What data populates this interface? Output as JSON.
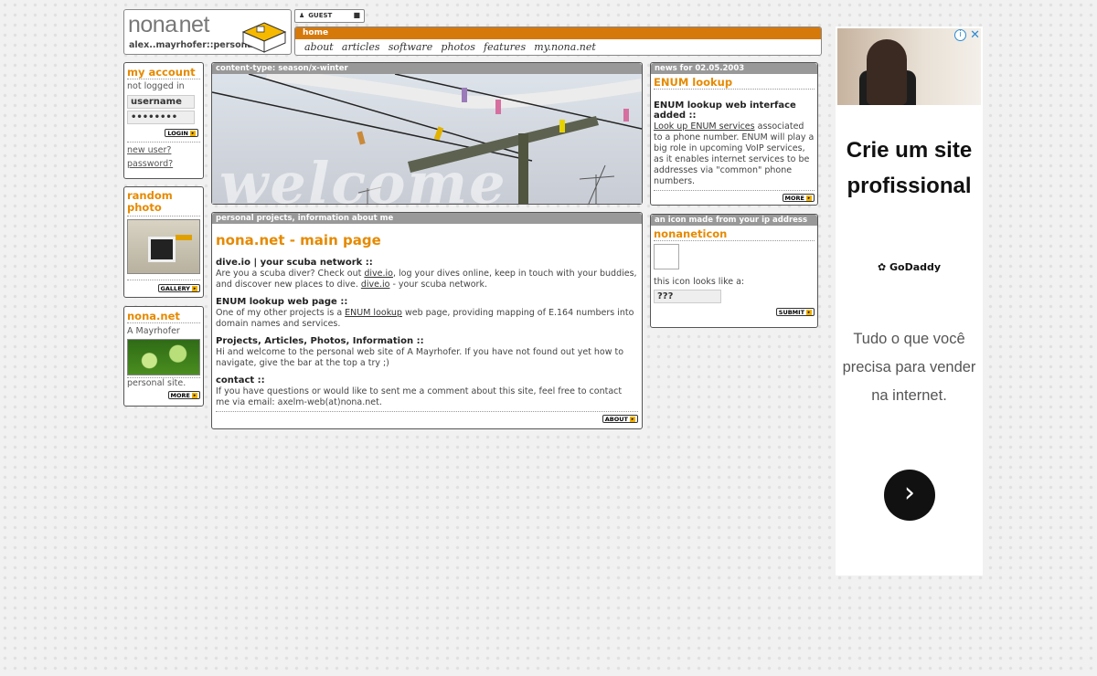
{
  "logo": {
    "site": "nona",
    "dot": ".",
    "tld": "net",
    "tagline": "alex..mayrhofer::personal"
  },
  "user_bar": {
    "label": "GUEST"
  },
  "nav": {
    "current": "home",
    "links": [
      "about",
      "articles",
      "software",
      "photos",
      "features",
      "my.nona.net"
    ]
  },
  "account": {
    "title": "my account",
    "status": "not logged in",
    "username_value": "username",
    "password_value": "••••••••",
    "login_button": "LOGIN",
    "new_user": "new user?",
    "forgot": "password?"
  },
  "random_photo": {
    "title": "random photo",
    "gallery_button": "GALLERY"
  },
  "nona_box": {
    "title": "nona.net",
    "owner": "A Mayrhofer",
    "caption": "personal site.",
    "more_button": "MORE"
  },
  "winter": {
    "tab": "content-type: season/x-winter",
    "overlay": "welcome"
  },
  "main": {
    "tab": "personal projects, information about me",
    "title": "nona.net - main page",
    "sections": [
      {
        "heading": "dive.io | your scuba network ::",
        "pre": "Are you a scuba diver? Check out ",
        "link1": "dive.io",
        "mid": ", log your dives online, keep in touch with your buddies, and discover new places to dive. ",
        "link2": "dive.io",
        "post": " - your scuba network."
      },
      {
        "heading": "ENUM lookup web page ::",
        "pre": "One of my other projects is a ",
        "link1": "ENUM lookup",
        "post": " web page, providing mapping of E.164 numbers into domain names and services."
      },
      {
        "heading": "Projects, Articles, Photos, Information ::",
        "text": "Hi and welcome to the personal web site of A Mayrhofer. If you have not found out yet how to navigate, give the bar at the top a try ;)"
      },
      {
        "heading": "contact ::",
        "text": "If you have questions or would like to sent me a comment about this site, feel free to contact me via email: axelm-web(at)nona.net."
      }
    ],
    "about_button": "ABOUT"
  },
  "news": {
    "tab": "news for 02.05.2003",
    "title": "ENUM lookup",
    "headline": "ENUM lookup web interface added ::",
    "link": "Look up ENUM services",
    "text": " associated to a phone number. ENUM will play a big role in upcoming VoIP services, as it enables internet services to be addresses via \"common\" phone numbers.",
    "more_button": "MORE"
  },
  "ipicon": {
    "tab": "an icon made from your ip address",
    "title": "nonaneticon",
    "looks_like": "this icon looks like a:",
    "value": "???",
    "submit_button": "SUBMIT"
  },
  "ad": {
    "headline": "Crie um site profissional",
    "brand": "GoDaddy",
    "body": "Tudo o que você precisa para vender na internet.",
    "info_icon": "info-icon",
    "close_icon": "close-icon",
    "arrow_icon": "chevron-right-icon"
  },
  "colors": {
    "accent": "#e68a00",
    "navbar": "#d6790b",
    "tab": "#999999"
  }
}
